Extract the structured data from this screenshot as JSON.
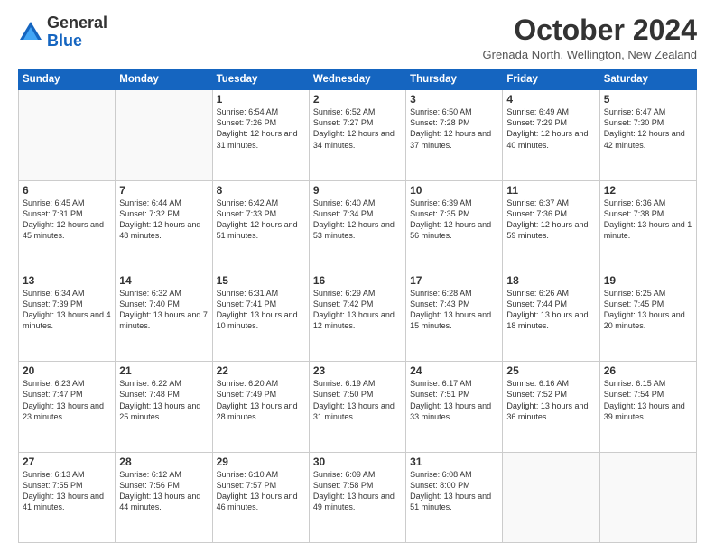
{
  "header": {
    "logo_general": "General",
    "logo_blue": "Blue",
    "month_title": "October 2024",
    "subtitle": "Grenada North, Wellington, New Zealand"
  },
  "days_of_week": [
    "Sunday",
    "Monday",
    "Tuesday",
    "Wednesday",
    "Thursday",
    "Friday",
    "Saturday"
  ],
  "weeks": [
    [
      {
        "day": "",
        "info": ""
      },
      {
        "day": "",
        "info": ""
      },
      {
        "day": "1",
        "info": "Sunrise: 6:54 AM\nSunset: 7:26 PM\nDaylight: 12 hours and 31 minutes."
      },
      {
        "day": "2",
        "info": "Sunrise: 6:52 AM\nSunset: 7:27 PM\nDaylight: 12 hours and 34 minutes."
      },
      {
        "day": "3",
        "info": "Sunrise: 6:50 AM\nSunset: 7:28 PM\nDaylight: 12 hours and 37 minutes."
      },
      {
        "day": "4",
        "info": "Sunrise: 6:49 AM\nSunset: 7:29 PM\nDaylight: 12 hours and 40 minutes."
      },
      {
        "day": "5",
        "info": "Sunrise: 6:47 AM\nSunset: 7:30 PM\nDaylight: 12 hours and 42 minutes."
      }
    ],
    [
      {
        "day": "6",
        "info": "Sunrise: 6:45 AM\nSunset: 7:31 PM\nDaylight: 12 hours and 45 minutes."
      },
      {
        "day": "7",
        "info": "Sunrise: 6:44 AM\nSunset: 7:32 PM\nDaylight: 12 hours and 48 minutes."
      },
      {
        "day": "8",
        "info": "Sunrise: 6:42 AM\nSunset: 7:33 PM\nDaylight: 12 hours and 51 minutes."
      },
      {
        "day": "9",
        "info": "Sunrise: 6:40 AM\nSunset: 7:34 PM\nDaylight: 12 hours and 53 minutes."
      },
      {
        "day": "10",
        "info": "Sunrise: 6:39 AM\nSunset: 7:35 PM\nDaylight: 12 hours and 56 minutes."
      },
      {
        "day": "11",
        "info": "Sunrise: 6:37 AM\nSunset: 7:36 PM\nDaylight: 12 hours and 59 minutes."
      },
      {
        "day": "12",
        "info": "Sunrise: 6:36 AM\nSunset: 7:38 PM\nDaylight: 13 hours and 1 minute."
      }
    ],
    [
      {
        "day": "13",
        "info": "Sunrise: 6:34 AM\nSunset: 7:39 PM\nDaylight: 13 hours and 4 minutes."
      },
      {
        "day": "14",
        "info": "Sunrise: 6:32 AM\nSunset: 7:40 PM\nDaylight: 13 hours and 7 minutes."
      },
      {
        "day": "15",
        "info": "Sunrise: 6:31 AM\nSunset: 7:41 PM\nDaylight: 13 hours and 10 minutes."
      },
      {
        "day": "16",
        "info": "Sunrise: 6:29 AM\nSunset: 7:42 PM\nDaylight: 13 hours and 12 minutes."
      },
      {
        "day": "17",
        "info": "Sunrise: 6:28 AM\nSunset: 7:43 PM\nDaylight: 13 hours and 15 minutes."
      },
      {
        "day": "18",
        "info": "Sunrise: 6:26 AM\nSunset: 7:44 PM\nDaylight: 13 hours and 18 minutes."
      },
      {
        "day": "19",
        "info": "Sunrise: 6:25 AM\nSunset: 7:45 PM\nDaylight: 13 hours and 20 minutes."
      }
    ],
    [
      {
        "day": "20",
        "info": "Sunrise: 6:23 AM\nSunset: 7:47 PM\nDaylight: 13 hours and 23 minutes."
      },
      {
        "day": "21",
        "info": "Sunrise: 6:22 AM\nSunset: 7:48 PM\nDaylight: 13 hours and 25 minutes."
      },
      {
        "day": "22",
        "info": "Sunrise: 6:20 AM\nSunset: 7:49 PM\nDaylight: 13 hours and 28 minutes."
      },
      {
        "day": "23",
        "info": "Sunrise: 6:19 AM\nSunset: 7:50 PM\nDaylight: 13 hours and 31 minutes."
      },
      {
        "day": "24",
        "info": "Sunrise: 6:17 AM\nSunset: 7:51 PM\nDaylight: 13 hours and 33 minutes."
      },
      {
        "day": "25",
        "info": "Sunrise: 6:16 AM\nSunset: 7:52 PM\nDaylight: 13 hours and 36 minutes."
      },
      {
        "day": "26",
        "info": "Sunrise: 6:15 AM\nSunset: 7:54 PM\nDaylight: 13 hours and 39 minutes."
      }
    ],
    [
      {
        "day": "27",
        "info": "Sunrise: 6:13 AM\nSunset: 7:55 PM\nDaylight: 13 hours and 41 minutes."
      },
      {
        "day": "28",
        "info": "Sunrise: 6:12 AM\nSunset: 7:56 PM\nDaylight: 13 hours and 44 minutes."
      },
      {
        "day": "29",
        "info": "Sunrise: 6:10 AM\nSunset: 7:57 PM\nDaylight: 13 hours and 46 minutes."
      },
      {
        "day": "30",
        "info": "Sunrise: 6:09 AM\nSunset: 7:58 PM\nDaylight: 13 hours and 49 minutes."
      },
      {
        "day": "31",
        "info": "Sunrise: 6:08 AM\nSunset: 8:00 PM\nDaylight: 13 hours and 51 minutes."
      },
      {
        "day": "",
        "info": ""
      },
      {
        "day": "",
        "info": ""
      }
    ]
  ]
}
